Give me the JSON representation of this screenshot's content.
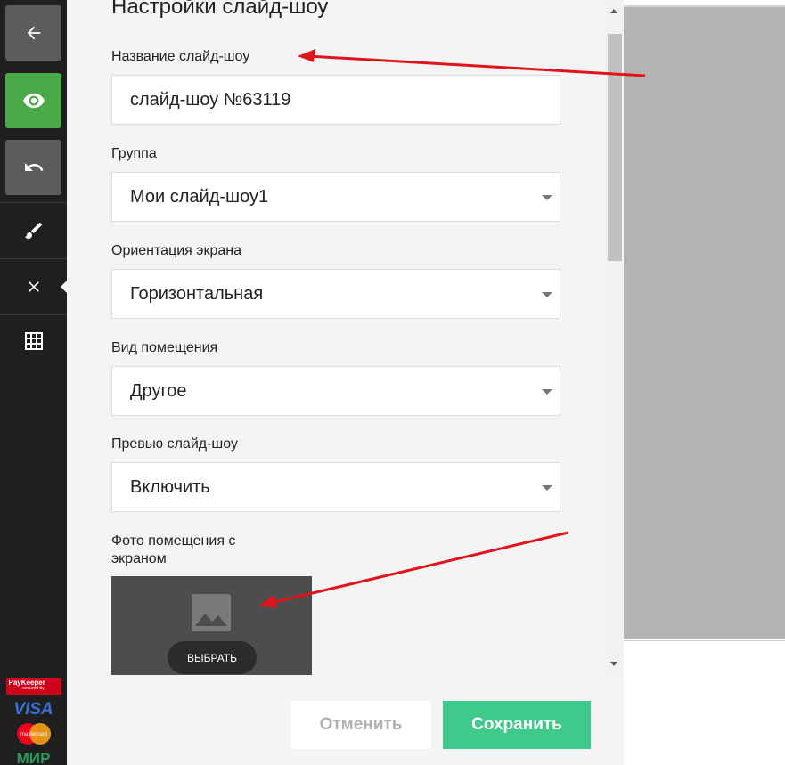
{
  "toolbar": {
    "buttons": [
      {
        "icon": "arrow-left-icon"
      },
      {
        "icon": "eye-icon",
        "color": "#4aaa47"
      },
      {
        "icon": "undo-icon"
      },
      {
        "icon": "brush-icon"
      },
      {
        "icon": "close-icon"
      },
      {
        "icon": "grid-icon"
      }
    ],
    "payment": {
      "paykeeper_label": "PayKeeper",
      "paykeeper_sub": "secured by",
      "visa": "VISA",
      "mastercard": "mastercard",
      "mir": "МИР"
    }
  },
  "panel": {
    "title": "Настройки слайд-шоу",
    "fields": {
      "name_label": "Название слайд-шоу",
      "name_value": "слайд-шоу №63119",
      "group_label": "Группа",
      "group_value": "Мои слайд-шоу1",
      "orientation_label": "Ориентация экрана",
      "orientation_value": "Горизонтальная",
      "room_label": "Вид помещения",
      "room_value": "Другое",
      "preview_label": "Превью слайд-шоу",
      "preview_value": "Включить",
      "photo_label_line1": "Фото помещения с",
      "photo_label_line2": "экраном",
      "choose_button": "ВЫБРАТЬ"
    },
    "actions": {
      "cancel": "Отменить",
      "save": "Сохранить"
    }
  },
  "colors": {
    "accent_green": "#3fca8c",
    "arrow_red": "#e0141c"
  }
}
